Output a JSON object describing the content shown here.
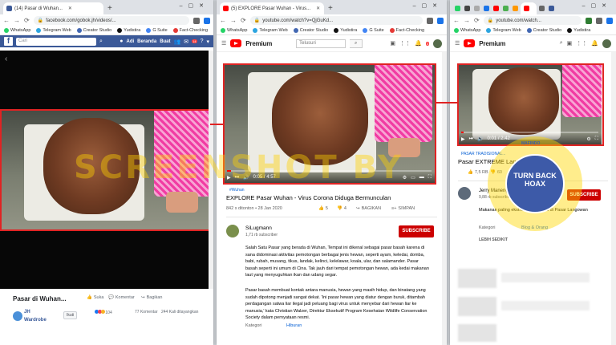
{
  "brand_colors": {
    "chrome_tabbar": "#dee1e6",
    "facebook_blue": "#3b5998",
    "youtube_red": "#ff0000",
    "highlight_red": "#e02323",
    "watermark_yellow": "#ffd200"
  },
  "bookmarks": [
    {
      "label": "WhatsApp",
      "icon": "whatsapp-icon",
      "color": "#25d366"
    },
    {
      "label": "Telegram Web",
      "icon": "telegram-icon",
      "color": "#2ca5e0"
    },
    {
      "label": "Creator Studio",
      "icon": "creator-studio-icon",
      "color": "#4267b2"
    },
    {
      "label": "Yudistira",
      "icon": "bookmark-icon",
      "color": "#111111"
    },
    {
      "label": "G Suite",
      "icon": "gsuite-icon",
      "color": "#4285f4"
    },
    {
      "label": "Fact-Checking",
      "icon": "fact-check-icon",
      "color": "#e53935"
    }
  ],
  "facebook": {
    "tab_title": "(14) Pasar di Wuhan...",
    "url": "facebook.com/gobok.jh/videos/...",
    "search_placeholder": "Cari",
    "nav": {
      "profile_name": "Adi",
      "home": "Beranda",
      "create": "Buat",
      "notif_count": "14"
    },
    "video_title": "Pasar di Wuhan...",
    "actions": {
      "like": "Suka",
      "comment": "Komentar",
      "share": "Bagikan"
    },
    "page_name": "JH Wardrobe",
    "suggest_label": "Ikuti",
    "reactions_count": "104",
    "comments": "77 Komentar",
    "views": "244 Kali ditayangkan"
  },
  "youtube1": {
    "tab_title": "(5) EXPLORE Pasar Wuhan - Virus...",
    "url": "youtube.com/watch?v=QjGuKd...",
    "brand": "Premium",
    "search_placeholder": "Telusuri",
    "notif_count": "3",
    "player_time": "0:05 / 4:57",
    "progress": 0.02,
    "tag": "#Wuhan",
    "title": "EXPLORE Pasar Wuhan - Virus Corona Diduga Bermunculan",
    "meta": "842 x ditonton • 28 Jan 2020",
    "likes": "5",
    "dislikes": "4",
    "share": "BAGIKAN",
    "save": "SIMPAN",
    "channel_name": "SiLugmann",
    "subscribers": "1,71 rb subscriber",
    "subscribe": "SUBSCRIBE",
    "desc_p1": "Salah Satu Pasar yang berada di Wuhan, Tempat ini dikenal sebagai pasar basah karena di sana didominasi aktivitas pemotongan berbagai jenis hewan, seperti ayam, keledai, domba, babi, rubah, musang, tikus, landak, kelinci, kelelawar, koala, ular, dan salamander. Pasar basah seperti ini umum di Cina. Tak jauh dari tempat pemotongan hewan, ada kedai makanan laut yang menyuguhkan ikan dan udang segar.",
    "desc_p2": "Pasar basah membuat kontak antara manusia, hewan yang masih hidup, dan binatang yang sudah dipotong menjadi sangat dekat. 'Ini pasar hewan yang diatur dengan buruk, ditambah perdagangan satwa liar ilegal jadi peluang bagi virus untuk menyebar dari hewan liar ke manusia,' kata Christian Walzer, Direktur Eksekutif Program Kesehatan Wildlife Conservation Society dalam pernyataan resmi.",
    "category_label": "Kategori",
    "category_value": "Hiburan"
  },
  "youtube2": {
    "tab_title": "youtube.com/watch...",
    "url": "youtube.com/watch...",
    "brand": "Premium",
    "player_time": "0:01 / 2:42",
    "progress": 0.01,
    "tag": "PASAR TRADISIONAL...",
    "title": "Pasar EXTREME Langowan",
    "likes": "7,5 RB",
    "dislikes": "60",
    "channel_name": "Jerry Manengkeng",
    "subscribers": "9,88 rb subscriber",
    "subscribe": "SUBSCRIBE",
    "desc": "Makanan paling ekstreme yang ada di Pasar Langowan",
    "category_label": "Kategori",
    "category_value": "Blog & Orang",
    "show_more": "LEBIH SEDIKIT"
  },
  "watermark": {
    "text": "SCREENSHOT BY",
    "seal_text": "TURN BACK HOAX",
    "seal_ring": "MAFINDO"
  }
}
